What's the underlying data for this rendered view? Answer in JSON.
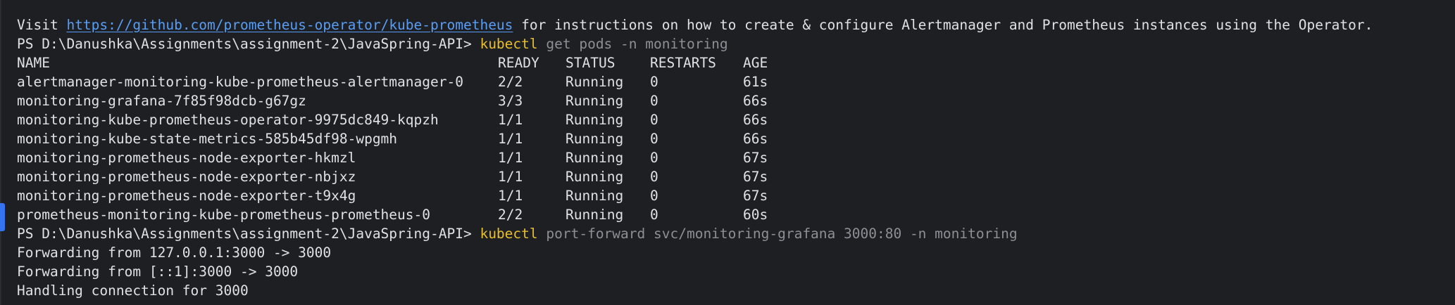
{
  "notice": {
    "prefix": "Visit ",
    "link": "https://github.com/prometheus-operator/kube-prometheus",
    "suffix": " for instructions on how to create & configure Alertmanager and Prometheus instances using the Operator."
  },
  "commands": [
    {
      "prompt": "PS D:\\Danushka\\Assignments\\assignment-2\\JavaSpring-API> ",
      "cmd": "kubectl",
      "args": " get pods -n monitoring"
    },
    {
      "prompt": "PS D:\\Danushka\\Assignments\\assignment-2\\JavaSpring-API> ",
      "cmd": "kubectl",
      "args": " port-forward svc/monitoring-grafana 3000:80 -n monitoring"
    }
  ],
  "pods_table": {
    "headers": [
      "NAME",
      "READY",
      "STATUS",
      "RESTARTS",
      "AGE"
    ],
    "rows": [
      [
        "alertmanager-monitoring-kube-prometheus-alertmanager-0",
        "2/2",
        "Running",
        "0",
        "61s"
      ],
      [
        "monitoring-grafana-7f85f98dcb-g67gz",
        "3/3",
        "Running",
        "0",
        "66s"
      ],
      [
        "monitoring-kube-prometheus-operator-9975dc849-kqpzh",
        "1/1",
        "Running",
        "0",
        "66s"
      ],
      [
        "monitoring-kube-state-metrics-585b45df98-wpgmh",
        "1/1",
        "Running",
        "0",
        "66s"
      ],
      [
        "monitoring-prometheus-node-exporter-hkmzl",
        "1/1",
        "Running",
        "0",
        "67s"
      ],
      [
        "monitoring-prometheus-node-exporter-nbjxz",
        "1/1",
        "Running",
        "0",
        "67s"
      ],
      [
        "monitoring-prometheus-node-exporter-t9x4g",
        "1/1",
        "Running",
        "0",
        "67s"
      ],
      [
        "prometheus-monitoring-kube-prometheus-prometheus-0",
        "2/2",
        "Running",
        "0",
        "60s"
      ]
    ]
  },
  "output": [
    "Forwarding from 127.0.0.1:3000 -> 3000",
    "Forwarding from [::1]:3000 -> 3000",
    "Handling connection for 3000"
  ],
  "colors": {
    "background": "#1e1f22",
    "text": "#dfe1e5",
    "link": "#589df6",
    "command": "#e8bf2a",
    "argument": "#8c8f94",
    "gutter_marker": "#3574f0"
  }
}
